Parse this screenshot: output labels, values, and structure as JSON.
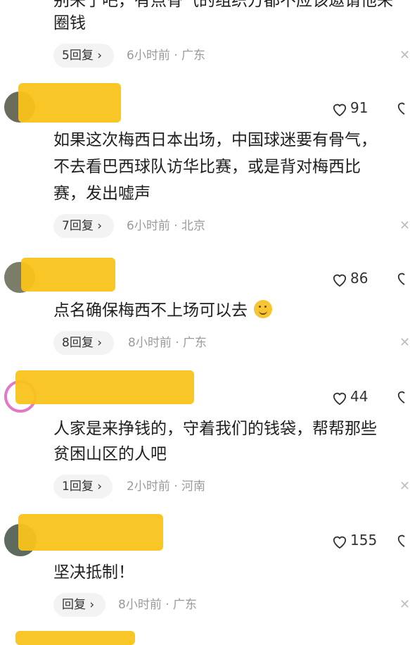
{
  "comments": [
    {
      "text_lines": [
        "别来了吧，有点骨气的组织方都不应该邀请他来",
        "圈钱"
      ],
      "reply_label": "5回复",
      "meta": "6小时前 · 广东"
    },
    {
      "likes": "91",
      "text_lines": [
        "如果这次梅西日本出场，中国球迷要有骨气，",
        "不去看巴西球队访华比赛，或是背对梅西比",
        "赛，发出嘘声"
      ],
      "reply_label": "7回复",
      "meta": "6小时前 · 北京"
    },
    {
      "likes": "86",
      "text_lines": [
        "点名确保梅西不上场可以去"
      ],
      "reply_label": "8回复",
      "meta": "8小时前 · 广东"
    },
    {
      "likes": "44",
      "text_lines": [
        "人家是来挣钱的，守着我们的钱袋，帮帮那些",
        "贫困山区的人吧"
      ],
      "reply_label": "1回复",
      "meta": "2小时前 · 河南"
    },
    {
      "likes": "155",
      "text_lines": [
        "坚决抵制！"
      ],
      "reply_label": "回复",
      "meta": "8小时前 · 广东"
    }
  ],
  "icons": {
    "close": "close-icon",
    "like": "heart-icon",
    "dislike": "broken-heart-icon",
    "chevron": "chevron-right-icon",
    "emoji": "smile-emoji-icon"
  },
  "colors": {
    "blur": "#f9c31b",
    "meta": "#9a9a9a",
    "pill_bg": "#f3f3f3"
  }
}
